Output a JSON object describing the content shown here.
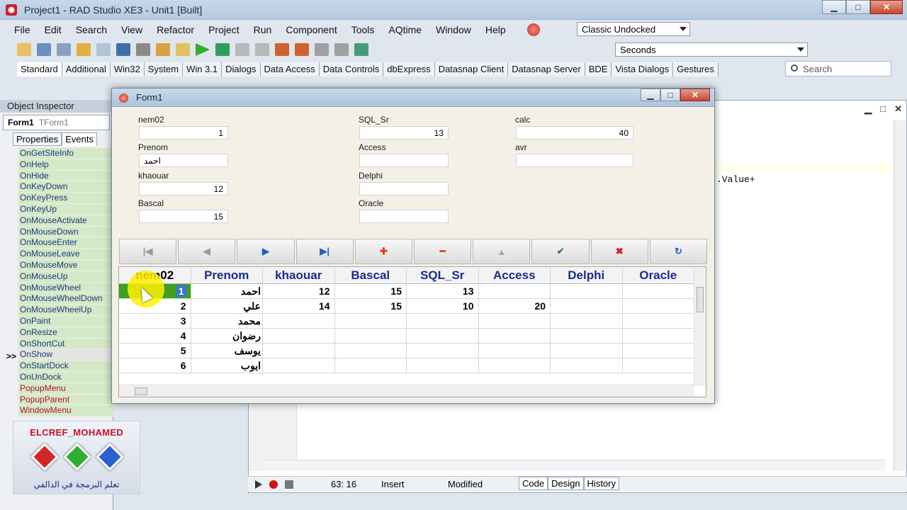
{
  "ide": {
    "title": "Project1 - RAD Studio XE3 - Unit1 [Built]",
    "menu": [
      "File",
      "Edit",
      "Search",
      "View",
      "Refactor",
      "Project",
      "Run",
      "Component",
      "Tools",
      "AQtime",
      "Window",
      "Help"
    ],
    "desktop_layout": "Classic Undocked",
    "seconds_combo": "Seconds",
    "palette_tabs": [
      "Standard",
      "Additional",
      "Win32",
      "System",
      "Win 3.1",
      "Dialogs",
      "Data Access",
      "Data Controls",
      "dbExpress",
      "Datasnap Client",
      "Datasnap Server",
      "BDE",
      "Vista Dialogs",
      "Gestures"
    ],
    "search_placeholder": "Search"
  },
  "object_inspector": {
    "title": "Object Inspector",
    "component_name": "Form1",
    "component_class": "TForm1",
    "tabs": [
      "Properties",
      "Events"
    ],
    "events": [
      {
        "name": "OnGetSiteInfo",
        "red": false
      },
      {
        "name": "OnHelp",
        "red": false
      },
      {
        "name": "OnHide",
        "red": false
      },
      {
        "name": "OnKeyDown",
        "red": false
      },
      {
        "name": "OnKeyPress",
        "red": false
      },
      {
        "name": "OnKeyUp",
        "red": false
      },
      {
        "name": "OnMouseActivate",
        "red": false
      },
      {
        "name": "OnMouseDown",
        "red": false
      },
      {
        "name": "OnMouseEnter",
        "red": false
      },
      {
        "name": "OnMouseLeave",
        "red": false
      },
      {
        "name": "OnMouseMove",
        "red": false
      },
      {
        "name": "OnMouseUp",
        "red": false
      },
      {
        "name": "OnMouseWheel",
        "red": false
      },
      {
        "name": "OnMouseWheelDown",
        "red": false
      },
      {
        "name": "OnMouseWheelUp",
        "red": false
      },
      {
        "name": "OnPaint",
        "red": false
      },
      {
        "name": "OnResize",
        "red": false
      },
      {
        "name": "OnShortCut",
        "red": false
      },
      {
        "name": "OnShow",
        "red": false
      },
      {
        "name": "OnStartDock",
        "red": false
      },
      {
        "name": "OnUnDock",
        "red": false
      },
      {
        "name": "PopupMenu",
        "red": true
      },
      {
        "name": "PopupParent",
        "red": true
      },
      {
        "name": "WindowMenu",
        "red": true
      }
    ],
    "selected_marker": ">>"
  },
  "editor": {
    "code_fragment": ".Value+",
    "cursor_pos": "63: 16",
    "mode": "Insert",
    "state": "Modified",
    "view_tabs": [
      "Code",
      "Design",
      "History"
    ]
  },
  "logo": {
    "brand": "ELCREF_MOHAMED",
    "tagline": "تعلم البرمجة في الدالفي"
  },
  "form1": {
    "title": "Form1",
    "fields": {
      "nem02": {
        "label": "nem02",
        "value": "1"
      },
      "prenom": {
        "label": "Prenom",
        "value": "احمد"
      },
      "khaouar": {
        "label": "khaouar",
        "value": "12"
      },
      "bascal": {
        "label": "Bascal",
        "value": "15"
      },
      "sql_sr": {
        "label": "SQL_Sr",
        "value": "13"
      },
      "access": {
        "label": "Access",
        "value": ""
      },
      "delphi": {
        "label": "Delphi",
        "value": ""
      },
      "oracle": {
        "label": "Oracle",
        "value": ""
      },
      "calc": {
        "label": "calc",
        "value": "40"
      },
      "avr": {
        "label": "avr",
        "value": ""
      }
    },
    "navigator": [
      {
        "name": "first",
        "glyph": "|◀",
        "color": "#9a9a9a"
      },
      {
        "name": "prior",
        "glyph": "◀",
        "color": "#9a9a9a"
      },
      {
        "name": "next",
        "glyph": "▶",
        "color": "#1f5fbf"
      },
      {
        "name": "last",
        "glyph": "▶|",
        "color": "#1f5fbf"
      },
      {
        "name": "insert",
        "glyph": "✚",
        "color": "#e04010"
      },
      {
        "name": "delete",
        "glyph": "━",
        "color": "#e04010"
      },
      {
        "name": "edit",
        "glyph": "▲",
        "color": "#aaaaaa"
      },
      {
        "name": "post",
        "glyph": "✔",
        "color": "#2f8f2f"
      },
      {
        "name": "cancel",
        "glyph": "✖",
        "color": "#d02020"
      },
      {
        "name": "refresh",
        "glyph": "↻",
        "color": "#1f5fbf"
      }
    ],
    "grid": {
      "columns": [
        "nem02",
        "Prenom",
        "khaouar",
        "Bascal",
        "SQL_Sr",
        "Access",
        "Delphi",
        "Oracle"
      ],
      "rows": [
        [
          "1",
          "احمد",
          "12",
          "15",
          "13",
          "",
          "",
          ""
        ],
        [
          "2",
          "علي",
          "14",
          "15",
          "10",
          "20",
          "",
          ""
        ],
        [
          "3",
          "محمد",
          "",
          "",
          "",
          "",
          "",
          ""
        ],
        [
          "4",
          "رضوان",
          "",
          "",
          "",
          "",
          "",
          ""
        ],
        [
          "5",
          "يوسف",
          "",
          "",
          "",
          "",
          "",
          ""
        ],
        [
          "6",
          "ايوب",
          "",
          "",
          "",
          "",
          "",
          ""
        ]
      ]
    }
  }
}
